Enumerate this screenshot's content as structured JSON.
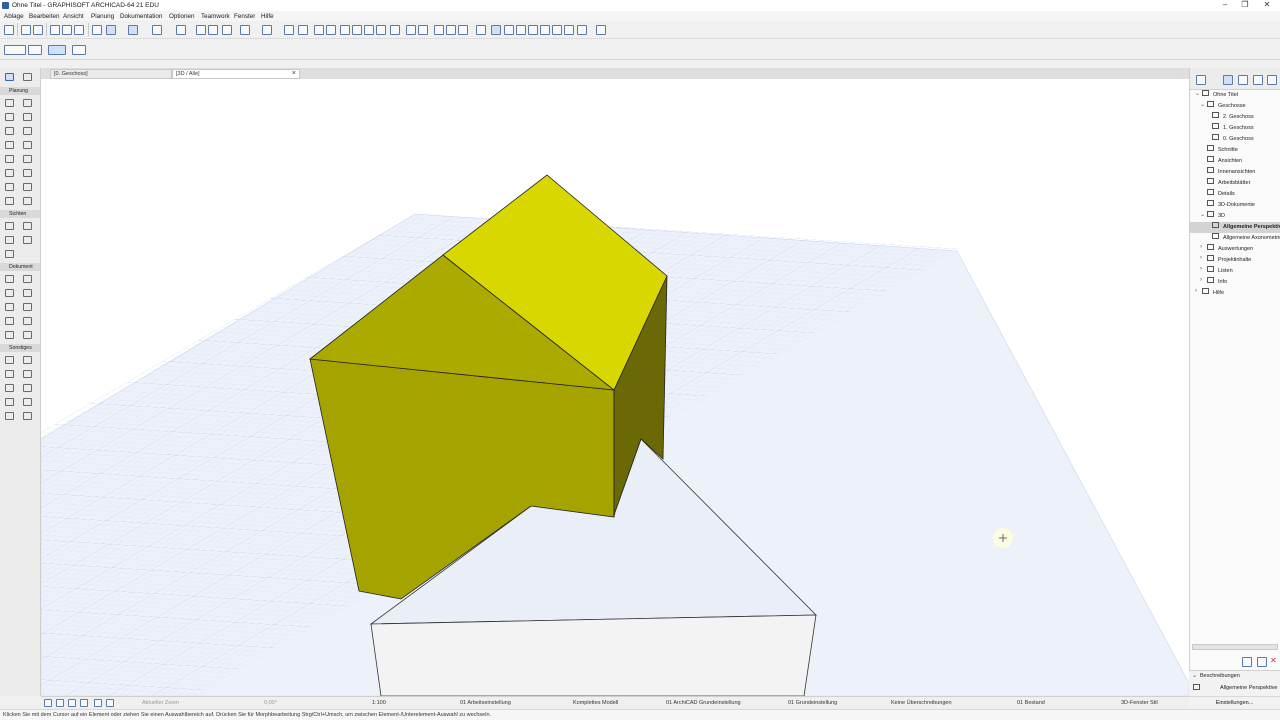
{
  "window": {
    "title": "Ohne Titel - GRAPHISOFT ARCHICAD-64 21 EDU",
    "minimize": "–",
    "maximize": "❐",
    "close": "✕"
  },
  "menu": [
    "Ablage",
    "Bearbeiten",
    "Ansicht",
    "Planung",
    "Dokumentation",
    "Optionen",
    "Teamwork",
    "Fenster",
    "Hilfe"
  ],
  "tabs": [
    {
      "label": "[0. Geschoss]"
    },
    {
      "label": "[3D / Alle]",
      "close": "×"
    }
  ],
  "toolbox": {
    "sections": [
      "Planung",
      "Sichten",
      "Dokument",
      "Sonstiges"
    ]
  },
  "navigator": {
    "root": "Ohne Titel",
    "items": [
      {
        "label": "Geschosse"
      },
      {
        "label": "2. Geschoss"
      },
      {
        "label": "1. Geschoss"
      },
      {
        "label": "0. Geschoss"
      },
      {
        "label": "Schnitte"
      },
      {
        "label": "Ansichten"
      },
      {
        "label": "Innenansichten"
      },
      {
        "label": "Arbeitsblätter"
      },
      {
        "label": "Details"
      },
      {
        "label": "3D-Dokumente"
      },
      {
        "label": "3D"
      },
      {
        "label": "Allgemeine Perspektive",
        "selected": true
      },
      {
        "label": "Allgemeine Axonometrie"
      },
      {
        "label": "Auswertungen"
      },
      {
        "label": "Projektinhalte"
      },
      {
        "label": "Listen"
      },
      {
        "label": "Info"
      },
      {
        "label": "Hilfe"
      }
    ],
    "properties_header": "Beschreibungen",
    "properties_value": "Allgemeine Perspektive",
    "settings_button": "Einstellungen..."
  },
  "statusbar": {
    "zoom": "Aktueller Zoom",
    "angle": "0,00°",
    "scale": "1:100",
    "layer_combo": "01 Arbeitseinstellung",
    "structure": "Komplettes Modell",
    "pen_set": "01 ArchiCAD Grundeinstellung",
    "model_view": "01 Grundeinstellung",
    "overrides": "Keine Überschreibungen",
    "renovation": "01 Bestand",
    "style_3d": "3D-Fenster Stil"
  },
  "message": "Klicken Sie mit dem Cursor auf ein Element oder ziehen Sie einen Auswahlbereich auf. Drücken Sie für Morphbearbeitung Strg/Ctrl+Umsch, um zwischen Element-/Unterelement-Auswahl zu wechseln.",
  "colors": {
    "roof_light": "#d8d800",
    "roof_dark": "#a8a800",
    "wall_front": "#a6a400",
    "wall_side": "#6b6a05",
    "grid": "#c9d5ef",
    "grid_bg": "#eef2fb",
    "accent": "#2c5fa8"
  }
}
